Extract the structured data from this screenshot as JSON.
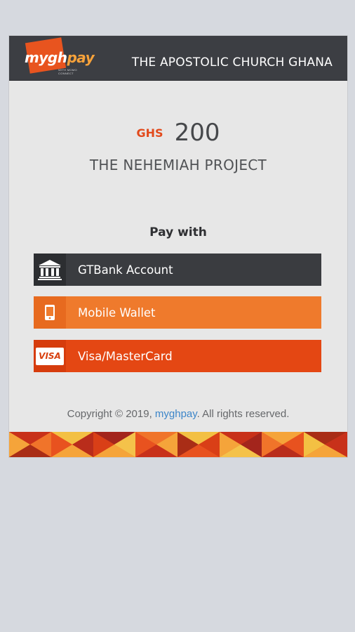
{
  "header": {
    "logo_my": "mygh",
    "logo_pay": "pay",
    "logo_tagline": "WITH MOMO CONNECT",
    "org_name": "THE APOSTOLIC CHURCH GHANA"
  },
  "payment": {
    "currency": "GHS",
    "amount": "200",
    "project": "THE NEHEMIAH PROJECT"
  },
  "pay_with": {
    "heading": "Pay with",
    "options": [
      {
        "label": "GTBank Account",
        "icon": "bank-icon",
        "color": "#3a3c40"
      },
      {
        "label": "Mobile Wallet",
        "icon": "mobile-phone-icon",
        "color": "#ef7a2c"
      },
      {
        "label": "Visa/MasterCard",
        "icon": "visa-card-icon",
        "badge": "VISA",
        "color": "#e44713"
      }
    ]
  },
  "footer": {
    "prefix": "Copyright © 2019, ",
    "link": "myghpay",
    "suffix": ". All rights reserved."
  },
  "colors": {
    "accent": "#e24a1c",
    "header_bg": "#3c3e43",
    "link": "#3d86c9"
  }
}
